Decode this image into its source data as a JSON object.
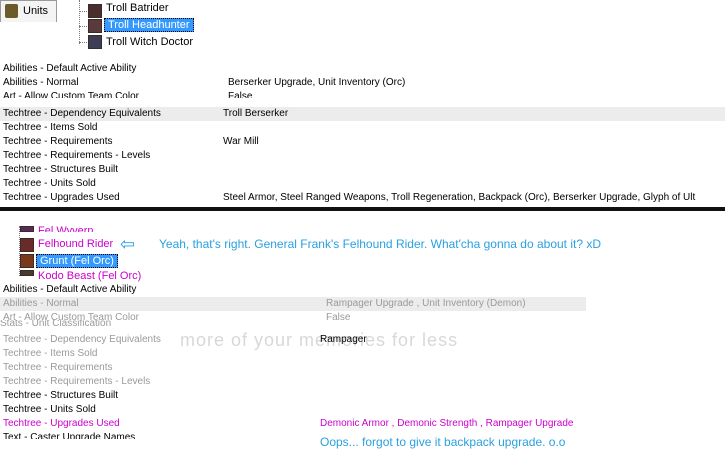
{
  "top": {
    "tab_label": "Units",
    "tree": [
      "Troll Batrider",
      "Troll Headhunter",
      "Troll Witch Doctor"
    ],
    "fields_before": [
      {
        "key": "Abilities - Default Active Ability",
        "value": ""
      },
      {
        "key": "Abilities - Normal",
        "value": "Berserker Upgrade, Unit Inventory (Orc)"
      },
      {
        "key": "Art - Allow Custom Team Color",
        "value": "False"
      }
    ],
    "fields": [
      {
        "key": "Techtree - Dependency Equivalents",
        "value": "Troll Berserker"
      },
      {
        "key": "Techtree - Items Sold",
        "value": ""
      },
      {
        "key": "Techtree - Requirements",
        "value": "War Mill"
      },
      {
        "key": "Techtree - Requirements - Levels",
        "value": ""
      },
      {
        "key": "Techtree - Structures Built",
        "value": ""
      },
      {
        "key": "Techtree - Units Sold",
        "value": ""
      },
      {
        "key": "Techtree - Upgrades Used",
        "value": "Steel Armor, Steel Ranged Weapons, Troll Regeneration, Backpack (Orc), Berserker Upgrade, Glyph of Ult"
      }
    ]
  },
  "bottom": {
    "tree": [
      "Fel Wyvern",
      "Felhound Rider",
      "Grunt (Fel Orc)",
      "Kodo Beast (Fel Orc)"
    ],
    "comment_1": "Yeah, that's right. General Frank's Felhound Rider. What'cha gonna do about it? xD",
    "fields": [
      {
        "key": "Abilities - Default Active Ability",
        "value": ""
      },
      {
        "key": "Abilities - Normal",
        "value": "Rampager Upgrade , Unit Inventory (Demon)"
      },
      {
        "key": "Art - Allow Custom Team Color",
        "value": "False"
      },
      {
        "key": "Stats - Unit Classification",
        "value": ""
      },
      {
        "key": "Techtree - Dependency Equivalents",
        "value": "Rampager"
      },
      {
        "key": "Techtree - Items Sold",
        "value": ""
      },
      {
        "key": "Techtree - Requirements",
        "value": ""
      },
      {
        "key": "Techtree - Requirements - Levels",
        "value": ""
      },
      {
        "key": "Techtree - Structures Built",
        "value": ""
      },
      {
        "key": "Techtree - Units Sold",
        "value": ""
      },
      {
        "key": "Techtree - Upgrades Used",
        "value": "Demonic Armor , Demonic Strength , Rampager Upgrade"
      },
      {
        "key": "Text - Caster Upgrade Names",
        "value": ""
      }
    ],
    "comment_2": "Oops... forgot to give it backpack upgrade. o.o",
    "watermark": "more of your memories for less"
  },
  "colors": {
    "selection": "#3399ff",
    "comment": "#2aa0e0",
    "modified": "#cc00cc"
  }
}
